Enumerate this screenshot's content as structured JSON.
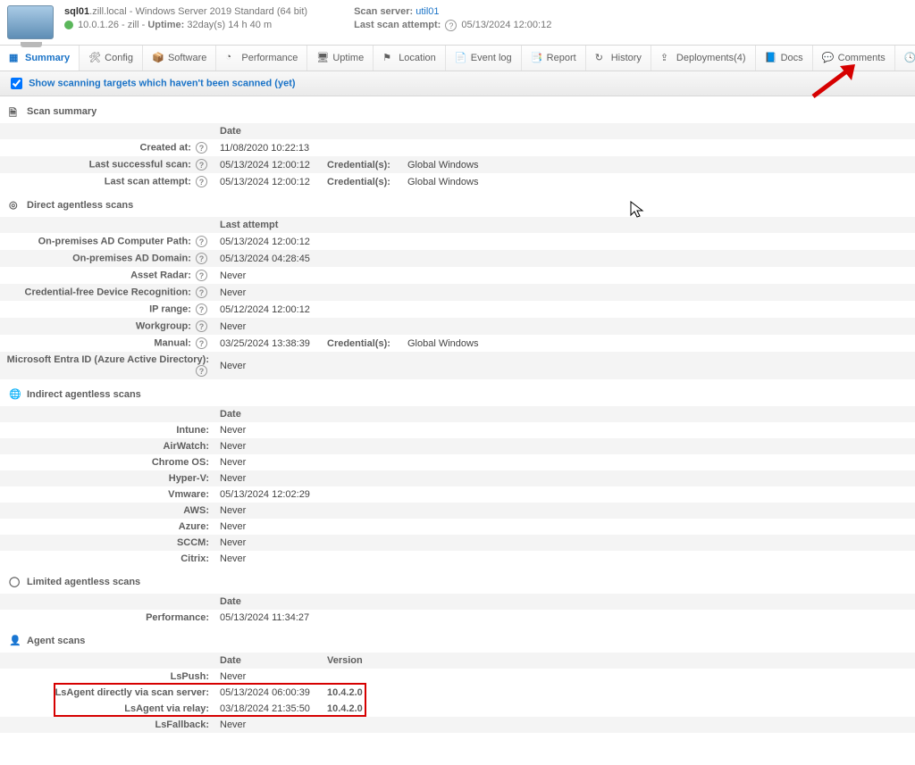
{
  "header": {
    "hostname": "sql01",
    "domain": ".zill.local",
    "os": " - Windows Server 2019 Standard (64 bit)",
    "ip": "10.0.1.26 - zill - ",
    "uptime_label": "Uptime:",
    "uptime": " 32day(s) 14 h 40 m",
    "scan_server_label": "Scan server: ",
    "scan_server": "util01",
    "last_attempt_label": "Last scan attempt: ",
    "last_attempt": "05/13/2024 12:00:12"
  },
  "tabs": {
    "summary": "Summary",
    "config": "Config",
    "software": "Software",
    "performance": "Performance",
    "uptime": "Uptime",
    "location": "Location",
    "eventlog": "Event log",
    "report": "Report",
    "history": "History",
    "deployments": "Deployments(4)",
    "docs": "Docs",
    "comments": "Comments",
    "scantime": "Scan time"
  },
  "filter": {
    "label": "Show scanning targets which haven't been scanned (yet)"
  },
  "sections": {
    "scan_summary": {
      "title": "Scan summary",
      "date_hdr": "Date",
      "rows": [
        {
          "label": "Created at:",
          "c1": "11/08/2020 10:22:13",
          "c2lbl": "",
          "c2": ""
        },
        {
          "label": "Last successful scan:",
          "c1": "05/13/2024 12:00:12",
          "c2lbl": "Credential(s):",
          "c2": "Global Windows"
        },
        {
          "label": "Last scan attempt:",
          "c1": "05/13/2024 12:00:12",
          "c2lbl": "Credential(s):",
          "c2": "Global Windows"
        }
      ]
    },
    "direct": {
      "title": "Direct agentless scans",
      "date_hdr": "Last attempt",
      "rows": [
        {
          "label": "On-premises AD Computer Path:",
          "c1": "05/13/2024 12:00:12",
          "c2lbl": "",
          "c2": ""
        },
        {
          "label": "On-premises AD Domain:",
          "c1": "05/13/2024 04:28:45",
          "c2lbl": "",
          "c2": ""
        },
        {
          "label": "Asset Radar:",
          "c1": "Never",
          "c2lbl": "",
          "c2": ""
        },
        {
          "label": "Credential-free Device Recognition:",
          "c1": "Never",
          "c2lbl": "",
          "c2": ""
        },
        {
          "label": "IP range:",
          "c1": "05/12/2024 12:00:12",
          "c2lbl": "",
          "c2": ""
        },
        {
          "label": "Workgroup:",
          "c1": "Never",
          "c2lbl": "",
          "c2": ""
        },
        {
          "label": "Manual:",
          "c1": "03/25/2024 13:38:39",
          "c2lbl": "Credential(s):",
          "c2": "Global Windows"
        },
        {
          "label": "Microsoft Entra ID (Azure Active Directory):",
          "c1": "Never",
          "c2lbl": "",
          "c2": ""
        }
      ]
    },
    "indirect": {
      "title": "Indirect agentless scans",
      "date_hdr": "Date",
      "rows": [
        {
          "label": "Intune:",
          "c1": "Never"
        },
        {
          "label": "AirWatch:",
          "c1": "Never"
        },
        {
          "label": "Chrome OS:",
          "c1": "Never"
        },
        {
          "label": "Hyper-V:",
          "c1": "Never"
        },
        {
          "label": "Vmware:",
          "c1": "05/13/2024 12:02:29"
        },
        {
          "label": "AWS:",
          "c1": "Never"
        },
        {
          "label": "Azure:",
          "c1": "Never"
        },
        {
          "label": "SCCM:",
          "c1": "Never"
        },
        {
          "label": "Citrix:",
          "c1": "Never"
        }
      ]
    },
    "limited": {
      "title": "Limited agentless scans",
      "date_hdr": "Date",
      "rows": [
        {
          "label": "Performance:",
          "c1": "05/13/2024 11:34:27"
        }
      ]
    },
    "agent": {
      "title": "Agent scans",
      "date_hdr": "Date",
      "ver_hdr": "Version",
      "rows": [
        {
          "label": "LsPush:",
          "c1": "Never",
          "c2": ""
        },
        {
          "label": "LsAgent directly via scan server:",
          "c1": "05/13/2024 06:00:39",
          "c2": "10.4.2.0",
          "hl": true
        },
        {
          "label": "LsAgent via relay:",
          "c1": "03/18/2024 21:35:50",
          "c2": "10.4.2.0",
          "hl": true
        },
        {
          "label": "LsFallback:",
          "c1": "Never",
          "c2": ""
        }
      ]
    }
  }
}
